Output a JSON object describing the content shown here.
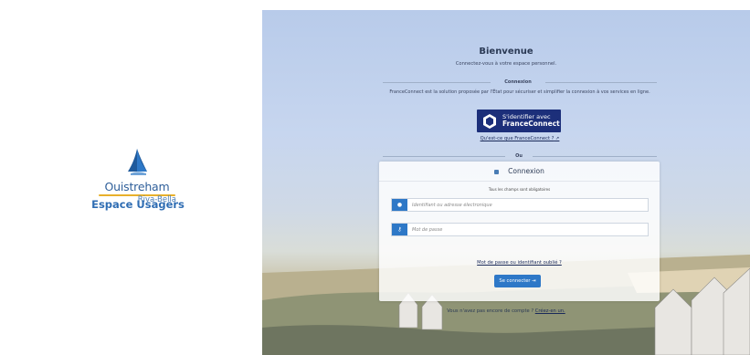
{
  "brand": {
    "name": "Ouistreham",
    "sub": "Riva-Bella",
    "portal": "Espace Usagers"
  },
  "welcome": {
    "title": "Bienvenue",
    "subtitle": "Connectez-vous à votre espace personnel."
  },
  "franceconnect": {
    "section_label": "Connexion",
    "description": "FranceConnect est la solution proposée par l'État pour sécuriser et simplifier la connexion à vos services en ligne.",
    "button_line1": "S'identifier avec",
    "button_line2": "FranceConnect",
    "info_link": "Qu'est-ce que FranceConnect ?"
  },
  "or_label": "Ou",
  "login": {
    "title": "Connexion",
    "required_note": "Tous les champs sont obligatoires",
    "username_placeholder": "Identifiant ou adresse électronique",
    "password_placeholder": "Mot de passe",
    "forgot_link": "Mot de passe ou identifiant oublié ?",
    "submit_label": "Se connecter"
  },
  "signup": {
    "question": "Vous n'avez pas encore de compte ?",
    "link": "Créez-en un."
  },
  "colors": {
    "primary": "#2e78c7",
    "franceconnect": "#1c2f7a",
    "brand": "#2f6db3",
    "accent": "#e8b02b"
  }
}
